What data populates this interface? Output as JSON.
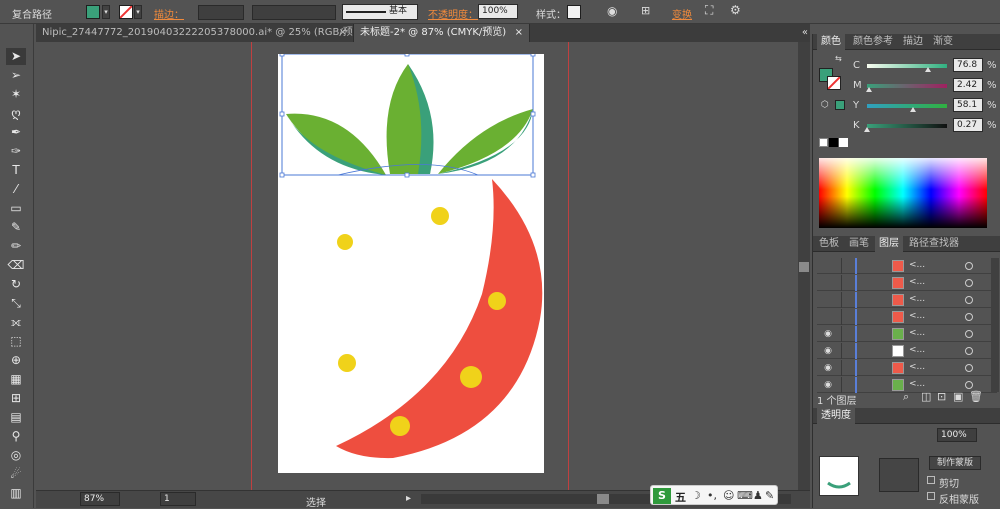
{
  "control_bar": {
    "object_type": "复合路径",
    "stroke_label": "描边：",
    "stroke_style": "基本",
    "opacity_label": "不透明度：",
    "opacity_value": "100%",
    "style_label": "样式：",
    "transform_label": "变换",
    "fill_color": "#3aa07a"
  },
  "tabs": [
    {
      "label": "Nipic_27447772_20190403222205378000.ai* @ 25% (RGB/预览)",
      "close": "×"
    },
    {
      "label": "未标题-2* @ 87% (CMYK/预览)",
      "close": "×"
    }
  ],
  "status": {
    "zoom": "87%",
    "page": "1",
    "tool": "选择"
  },
  "color_panel": {
    "tabs": [
      "颜色",
      "颜色参考",
      "描边",
      "渐变"
    ],
    "channels": [
      {
        "label": "C",
        "value": "76.8",
        "unit": "%",
        "fraction": 0.768
      },
      {
        "label": "M",
        "value": "2.42",
        "unit": "%",
        "fraction": 0.024
      },
      {
        "label": "Y",
        "value": "58.1",
        "unit": "%",
        "fraction": 0.581
      },
      {
        "label": "K",
        "value": "0.27",
        "unit": "%",
        "fraction": 0.003
      }
    ],
    "current_color": "#3aa07a"
  },
  "layers_panel": {
    "tabs": [
      "色板",
      "画笔",
      "图层",
      "路径查找器"
    ],
    "row_label": "<...",
    "rows": [
      {
        "thumb": "#ee5a4a",
        "visible": false
      },
      {
        "thumb": "#ee5a4a",
        "visible": false
      },
      {
        "thumb": "#ee5a4a",
        "visible": false
      },
      {
        "thumb": "#ee5a4a",
        "visible": false
      },
      {
        "thumb": "#6ab04c",
        "visible": true
      },
      {
        "thumb": "#ffffff",
        "visible": true
      },
      {
        "thumb": "#ee5a4a",
        "visible": true
      },
      {
        "thumb": "#6ab04c",
        "visible": true
      }
    ],
    "footer": "1 个图层"
  },
  "transparency_panel": {
    "title": "透明度",
    "opacity": "100%",
    "make_mask": "制作蒙版",
    "clip": "剪切",
    "invert_mask": "反相蒙版"
  },
  "ime_bar": {
    "logo": "S",
    "mode": "五"
  },
  "colors": {
    "strawberry_red": "#ee4e3f",
    "seed_yellow": "#f0d21a",
    "leaf_green": "#6ab032",
    "leaf_teal": "#3aa07a",
    "selection_blue": "#4a78d6"
  }
}
